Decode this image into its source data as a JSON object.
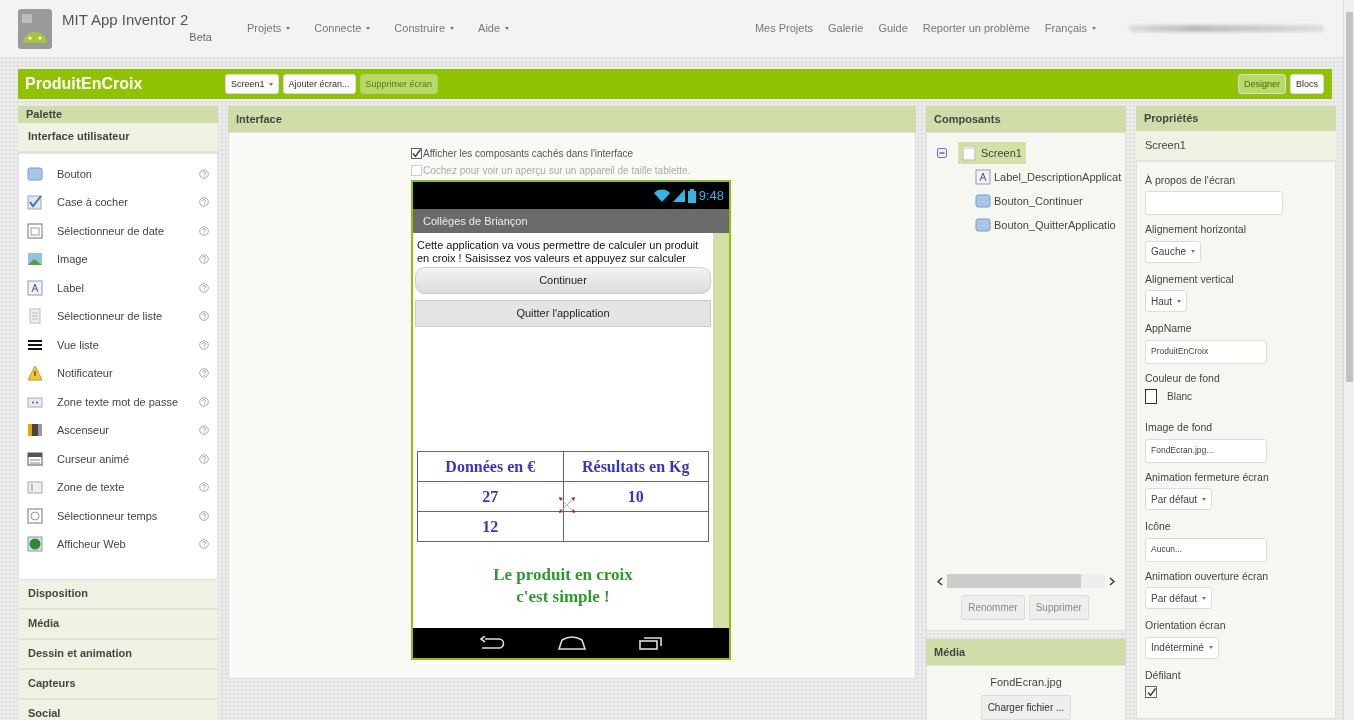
{
  "app": {
    "name": "MIT App Inventor 2",
    "edition": "Beta"
  },
  "menu": [
    {
      "label": "Projets",
      "dropdown": true
    },
    {
      "label": "Connecte",
      "dropdown": true
    },
    {
      "label": "Construire",
      "dropdown": true
    },
    {
      "label": "Aide",
      "dropdown": true
    }
  ],
  "top_links": [
    {
      "label": "Mes Projets",
      "dropdown": false
    },
    {
      "label": "Galerie",
      "dropdown": false
    },
    {
      "label": "Guide",
      "dropdown": false
    },
    {
      "label": "Reporter un problème",
      "dropdown": false
    },
    {
      "label": "Français",
      "dropdown": true
    }
  ],
  "project": {
    "title": "ProduitEnCroix",
    "screen_select": "Screen1",
    "add_screen": {
      "label": "Ajouter écran...",
      "disabled": false
    },
    "remove_screen": {
      "label": "Supprimer écran",
      "disabled": true
    }
  },
  "view_buttons": [
    {
      "label": "Designer",
      "selected": true
    },
    {
      "label": "Blocs",
      "selected": false
    }
  ],
  "palette": {
    "title": "Palette",
    "groups": [
      {
        "label": "Interface utilisateur",
        "expanded": true,
        "items": [
          {
            "label": "Bouton",
            "kind": "button"
          },
          {
            "label": "Case à cocher",
            "kind": "checkbox"
          },
          {
            "label": "Sélectionneur de date",
            "kind": "datepicker"
          },
          {
            "label": "Image",
            "kind": "image"
          },
          {
            "label": "Label",
            "kind": "label"
          },
          {
            "label": "Sélectionneur de liste",
            "kind": "listpicker"
          },
          {
            "label": "Vue liste",
            "kind": "listview"
          },
          {
            "label": "Notificateur",
            "kind": "notifier"
          },
          {
            "label": "Zone texte mot de passe",
            "kind": "password"
          },
          {
            "label": "Ascenseur",
            "kind": "slider"
          },
          {
            "label": "Curseur animé",
            "kind": "spinner"
          },
          {
            "label": "Zone de texte",
            "kind": "textbox"
          },
          {
            "label": "Sélectionneur temps",
            "kind": "timepicker"
          },
          {
            "label": "Afficheur Web",
            "kind": "webviewer"
          }
        ]
      },
      {
        "label": "Disposition",
        "expanded": false
      },
      {
        "label": "Média",
        "expanded": false
      },
      {
        "label": "Dessin et animation",
        "expanded": false
      },
      {
        "label": "Capteurs",
        "expanded": false
      },
      {
        "label": "Social",
        "expanded": false
      }
    ]
  },
  "interface": {
    "title": "Interface",
    "options": [
      {
        "label": "Afficher les composants cachés dans l'interface",
        "checked": true,
        "disabled": false
      },
      {
        "label": "Cochez pour voir un aperçu sur un appareil de taille tablette.",
        "checked": false,
        "disabled": true
      }
    ],
    "phone": {
      "time": "9:48",
      "title": "Collèges de Briançon",
      "description": "Cette application va vous permettre de calculer un produit en croix ! Saisissez vos valeurs et appuyez sur calculer",
      "buttons": [
        {
          "label": "Continuer",
          "kind": "rounded"
        },
        {
          "label": "Quitter l'application",
          "kind": "flat"
        }
      ],
      "table": {
        "columns": [
          "Données en €",
          "Résultats en Kg"
        ],
        "rows": [
          [
            "27",
            "10"
          ],
          [
            "12"
          ]
        ]
      },
      "slogan": [
        "Le produit en croix",
        "c'est simple !"
      ]
    }
  },
  "components": {
    "title": "Composants",
    "tree": [
      {
        "label": "Screen1",
        "kind": "screen",
        "selected": true,
        "expanded": true,
        "children": [
          {
            "label": "Label_DescriptionApplicat",
            "kind": "label",
            "selected": false
          },
          {
            "label": "Bouton_Continuer",
            "kind": "button",
            "selected": false
          },
          {
            "label": "Bouton_QuitterApplicatio",
            "kind": "button",
            "selected": false
          }
        ]
      }
    ],
    "buttons": [
      {
        "label": "Renommer",
        "disabled": true
      },
      {
        "label": "Supprimer",
        "disabled": true
      }
    ]
  },
  "media": {
    "title": "Média",
    "files": [
      "FondEcran.jpg"
    ],
    "upload": "Charger fichier ..."
  },
  "properties": {
    "title": "Propriétés",
    "component": "Screen1",
    "items": [
      {
        "label": "À propos de l'écran",
        "kind": "textarea"
      },
      {
        "label": "Alignement horizontal",
        "kind": "select",
        "value": "Gauche"
      },
      {
        "label": "Alignement vertical",
        "kind": "select",
        "value": "Haut"
      },
      {
        "label": "AppName",
        "kind": "text",
        "value": "ProduitEnCroix"
      },
      {
        "label": "Couleur de fond",
        "kind": "color",
        "value": "Blanc",
        "color": "#ffffff"
      },
      {
        "label": "Image de fond",
        "kind": "text",
        "value": "FondEcran.jpg..."
      },
      {
        "label": "Animation fermeture écran",
        "kind": "select",
        "value": "Par défaut"
      },
      {
        "label": "Icône",
        "kind": "text",
        "value": "Aucun..."
      },
      {
        "label": "Animation ouverture écran",
        "kind": "select",
        "value": "Par défaut"
      },
      {
        "label": "Orientation écran",
        "kind": "select",
        "value": "Indéterminé"
      },
      {
        "label": "Défilant",
        "kind": "checkbox",
        "checked": true
      }
    ]
  }
}
